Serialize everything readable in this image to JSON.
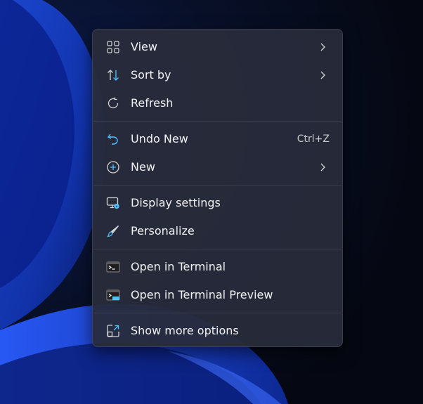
{
  "colors": {
    "accent": "#4cc2ff",
    "icon_gray": "#d6d6d6",
    "text": "#f2f2f2",
    "shortcut_text": "#c8c8c8",
    "menu_bg": "#282c3a"
  },
  "context_menu": {
    "items": [
      {
        "label": "View",
        "icon": "grid-icon",
        "submenu": true
      },
      {
        "label": "Sort by",
        "icon": "sort-arrows-icon",
        "submenu": true
      },
      {
        "label": "Refresh",
        "icon": "refresh-icon",
        "submenu": false
      },
      {
        "label": "Undo New",
        "icon": "undo-icon",
        "shortcut": "Ctrl+Z"
      },
      {
        "label": "New",
        "icon": "plus-circle-icon",
        "submenu": true
      },
      {
        "label": "Display settings",
        "icon": "display-settings-icon"
      },
      {
        "label": "Personalize",
        "icon": "brush-icon"
      },
      {
        "label": "Open in Terminal",
        "icon": "terminal-icon"
      },
      {
        "label": "Open in Terminal Preview",
        "icon": "terminal-preview-icon"
      },
      {
        "label": "Show more options",
        "icon": "show-more-icon"
      }
    ]
  }
}
